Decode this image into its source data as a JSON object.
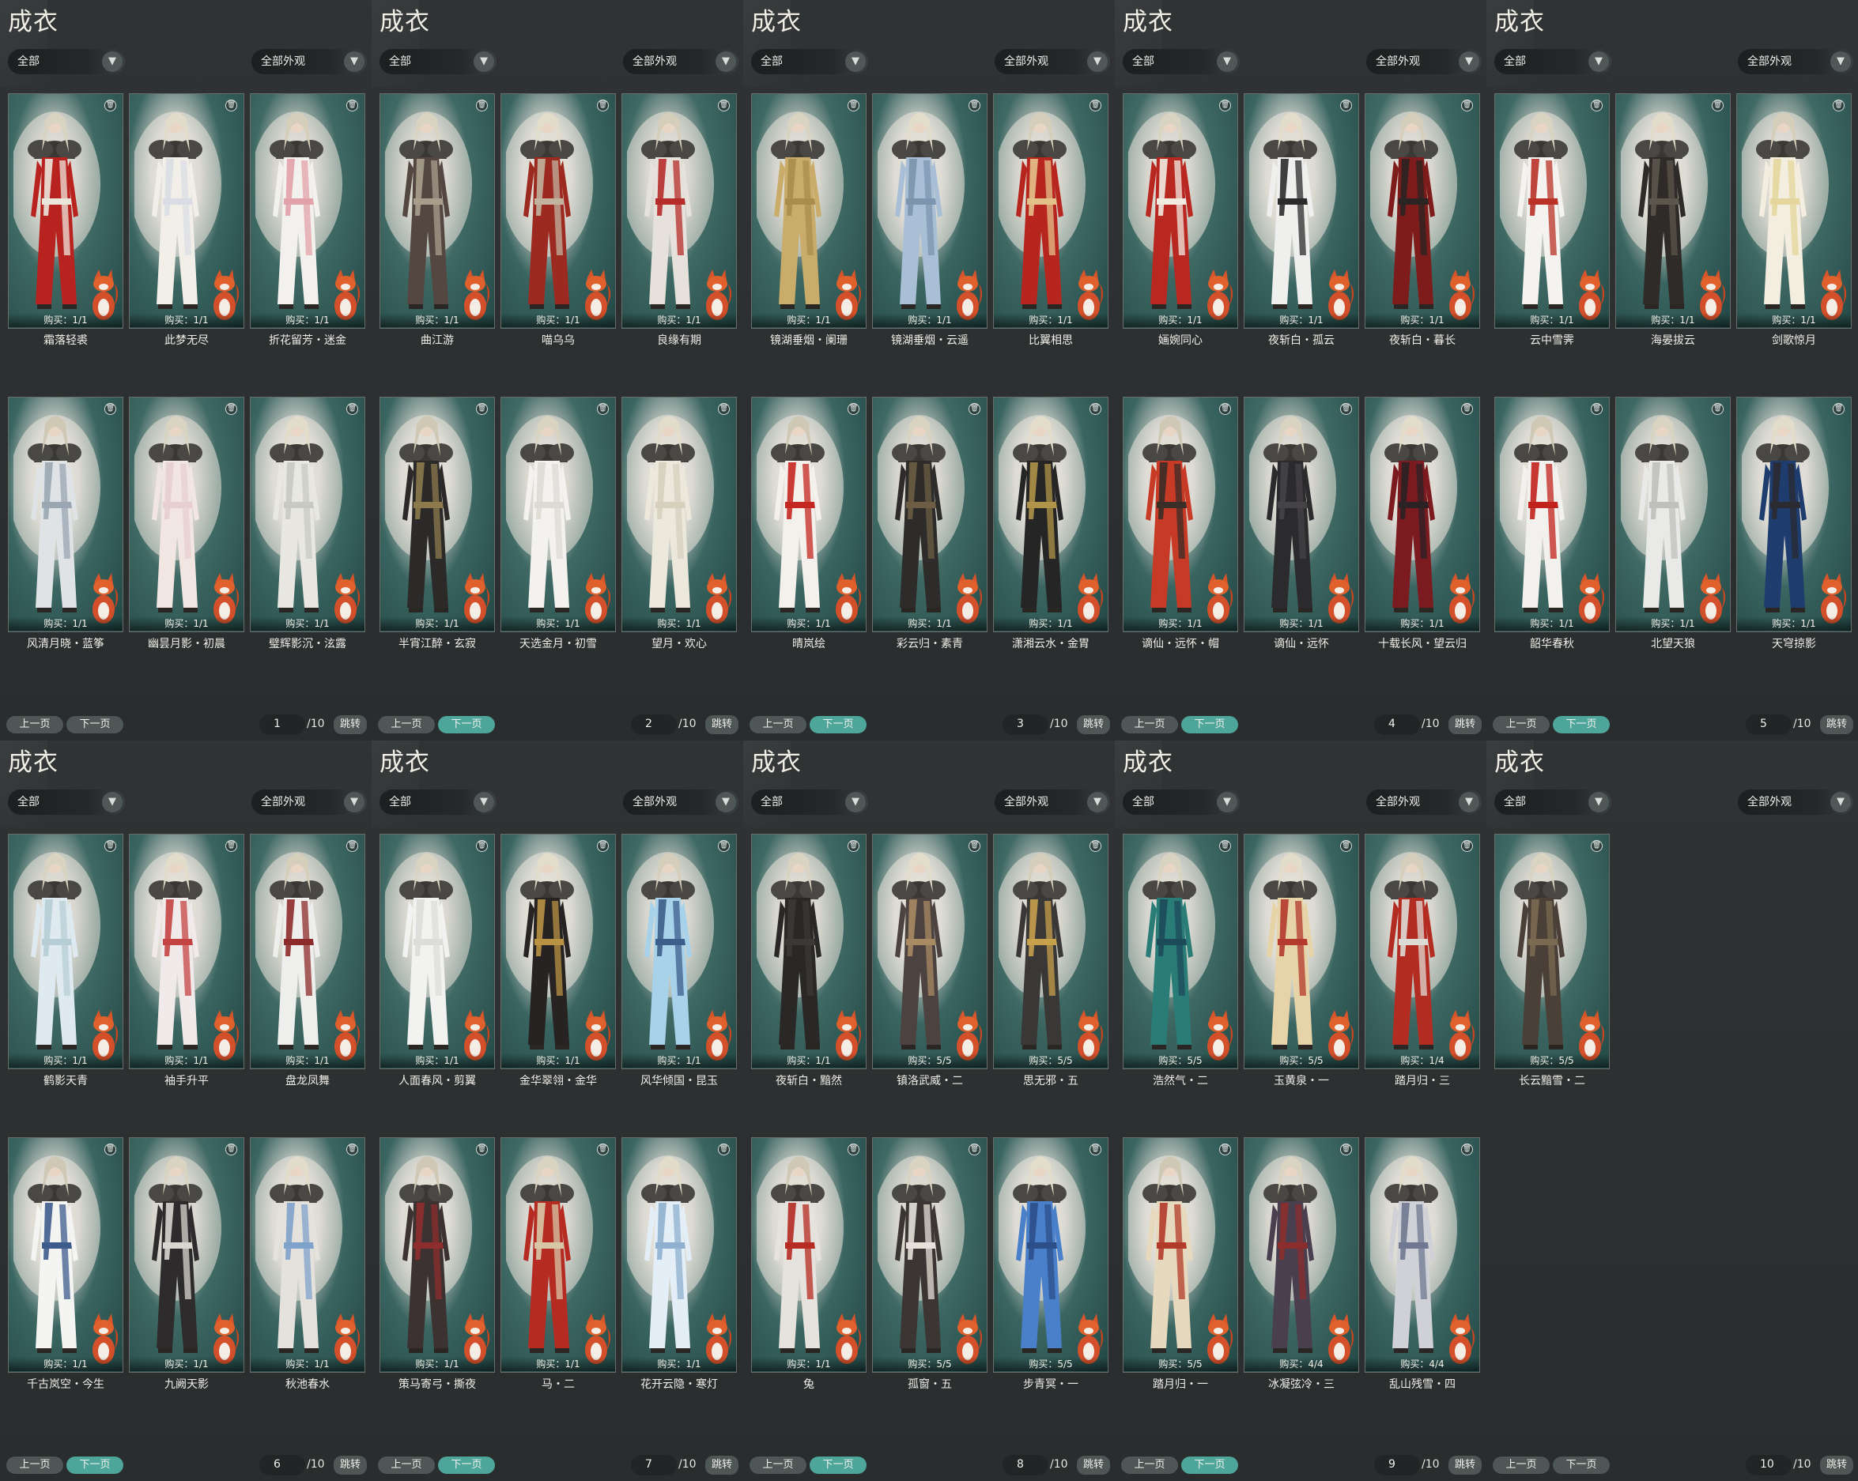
{
  "panel_title": "成衣",
  "filter_all": "全部",
  "filter_look": "全部外观",
  "prev_label": "上一页",
  "next_label": "下一页",
  "jump_label": "跳转",
  "total_pages": "/10",
  "panels": [
    {
      "page": "1",
      "items": [
        {
          "name": "霜落轻裘",
          "buy": "购买：1/1"
        },
        {
          "name": "此梦无尽",
          "buy": "购买：1/1"
        },
        {
          "name": "折花留芳・迷金",
          "buy": "购买：1/1"
        },
        {
          "name": "风清月晓・蓝筝",
          "buy": "购买：1/1"
        },
        {
          "name": "幽昙月影・初晨",
          "buy": "购买：1/1"
        },
        {
          "name": "璧辉影沉・泫露",
          "buy": "购买：1/1"
        }
      ]
    },
    {
      "page": "2",
      "items": [
        {
          "name": "曲江游",
          "buy": "购买：1/1"
        },
        {
          "name": "喵乌乌",
          "buy": "购买：1/1"
        },
        {
          "name": "良缘有期",
          "buy": "购买：1/1"
        },
        {
          "name": "半宵江醉・玄寂",
          "buy": "购买：1/1"
        },
        {
          "name": "天选金月・初雪",
          "buy": "购买：1/1"
        },
        {
          "name": "望月・欢心",
          "buy": "购买：1/1"
        }
      ]
    },
    {
      "page": "3",
      "items": [
        {
          "name": "镜湖垂烟・阑珊",
          "buy": "购买：1/1"
        },
        {
          "name": "镜湖垂烟・云遥",
          "buy": "购买：1/1"
        },
        {
          "name": "比翼相思",
          "buy": "购买：1/1"
        },
        {
          "name": "晴岚绘",
          "buy": "购买：1/1"
        },
        {
          "name": "彩云归・素青",
          "buy": "购买：1/1"
        },
        {
          "name": "潇湘云水・金胃",
          "buy": "购买：1/1"
        }
      ]
    },
    {
      "page": "4",
      "items": [
        {
          "name": "婳婉同心",
          "buy": "购买：1/1"
        },
        {
          "name": "夜斩白・孤云",
          "buy": "购买：1/1"
        },
        {
          "name": "夜斩白・暮长",
          "buy": "购买：1/1"
        },
        {
          "name": "谪仙・远怀・帽",
          "buy": "购买：1/1"
        },
        {
          "name": "谪仙・远怀",
          "buy": "购买：1/1"
        },
        {
          "name": "十载长风・望云归",
          "buy": "购买：1/1"
        }
      ]
    },
    {
      "page": "5",
      "items": [
        {
          "name": "云中雪霁",
          "buy": "购买：1/1"
        },
        {
          "name": "海晏拔云",
          "buy": "购买：1/1"
        },
        {
          "name": "剑歌惊月",
          "buy": "购买：1/1"
        },
        {
          "name": "韶华春秋",
          "buy": "购买：1/1"
        },
        {
          "name": "北望天狼",
          "buy": "购买：1/1"
        },
        {
          "name": "天穹掠影",
          "buy": "购买：1/1"
        }
      ]
    },
    {
      "page": "6",
      "items": [
        {
          "name": "鹤影天青",
          "buy": "购买：1/1"
        },
        {
          "name": "袖手升平",
          "buy": "购买：1/1"
        },
        {
          "name": "盘龙凤舞",
          "buy": "购买：1/1"
        },
        {
          "name": "千古岚空・今生",
          "buy": "购买：1/1"
        },
        {
          "name": "九阙天影",
          "buy": "购买：1/1"
        },
        {
          "name": "秋池春水",
          "buy": "购买：1/1"
        }
      ]
    },
    {
      "page": "7",
      "items": [
        {
          "name": "人面春风・剪翼",
          "buy": "购买：1/1"
        },
        {
          "name": "金华翠翎・金华",
          "buy": "购买：1/1"
        },
        {
          "name": "风华倾国・昆玉",
          "buy": "购买：1/1"
        },
        {
          "name": "策马寄弓・撕夜",
          "buy": "购买：1/1"
        },
        {
          "name": "马・二",
          "buy": "购买：1/1"
        },
        {
          "name": "花开云隐・寒灯",
          "buy": "购买：1/1"
        }
      ]
    },
    {
      "page": "8",
      "items": [
        {
          "name": "夜斩白・黯然",
          "buy": "购买：1/1"
        },
        {
          "name": "镇洛武威・二",
          "buy": "购买：5/5"
        },
        {
          "name": "思无邪・五",
          "buy": "购买：5/5"
        },
        {
          "name": "兔",
          "buy": "购买：1/1"
        },
        {
          "name": "孤窗・五",
          "buy": "购买：5/5"
        },
        {
          "name": "步青冥・一",
          "buy": "购买：5/5"
        }
      ]
    },
    {
      "page": "9",
      "items": [
        {
          "name": "浩然气・二",
          "buy": "购买：5/5"
        },
        {
          "name": "玉黄泉・一",
          "buy": "购买：5/5"
        },
        {
          "name": "踏月归・三",
          "buy": "购买：1/4"
        },
        {
          "name": "踏月归・一",
          "buy": "购买：5/5"
        },
        {
          "name": "冰凝弦冷・三",
          "buy": "购买：4/4"
        },
        {
          "name": "乱山残雪・四",
          "buy": "购买：4/4"
        }
      ]
    },
    {
      "page": "10",
      "items": [
        {
          "name": "长云黯雪・二",
          "buy": "购买：5/5"
        }
      ]
    }
  ],
  "colors": {
    "bg": "#2b2e2f",
    "card_teal": "#244a47",
    "next_active": "#4ea59a",
    "button_gray": "#4e5656"
  },
  "icons": [
    "trash-icon",
    "chevron-down-icon"
  ]
}
